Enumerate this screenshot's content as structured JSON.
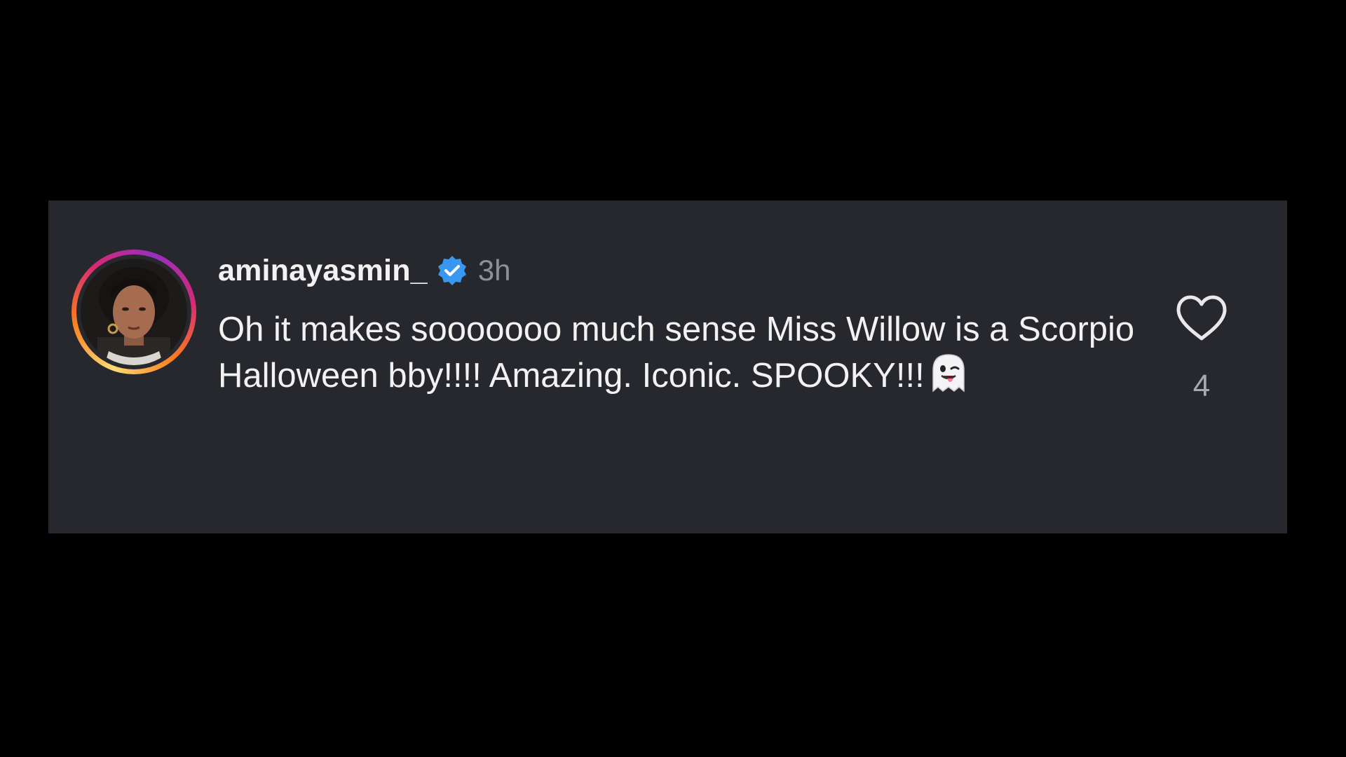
{
  "comment": {
    "username": "aminayasmin_",
    "verified": true,
    "time": "3h",
    "text": "Oh it makes sooooooo much sense Miss Willow is a Scorpio Halloween bby!!!! Amazing. Iconic. SPOOKY!!!",
    "emoji_icon": "ghost-icon",
    "like_count": "4"
  },
  "icons": {
    "verified": "verified-badge-icon",
    "like": "heart-outline-icon"
  },
  "colors": {
    "page_background": "#000000",
    "card_background": "#26282d",
    "text_primary": "#f2f2f2",
    "text_secondary": "#8e9096",
    "verified_blue": "#3897f0"
  }
}
